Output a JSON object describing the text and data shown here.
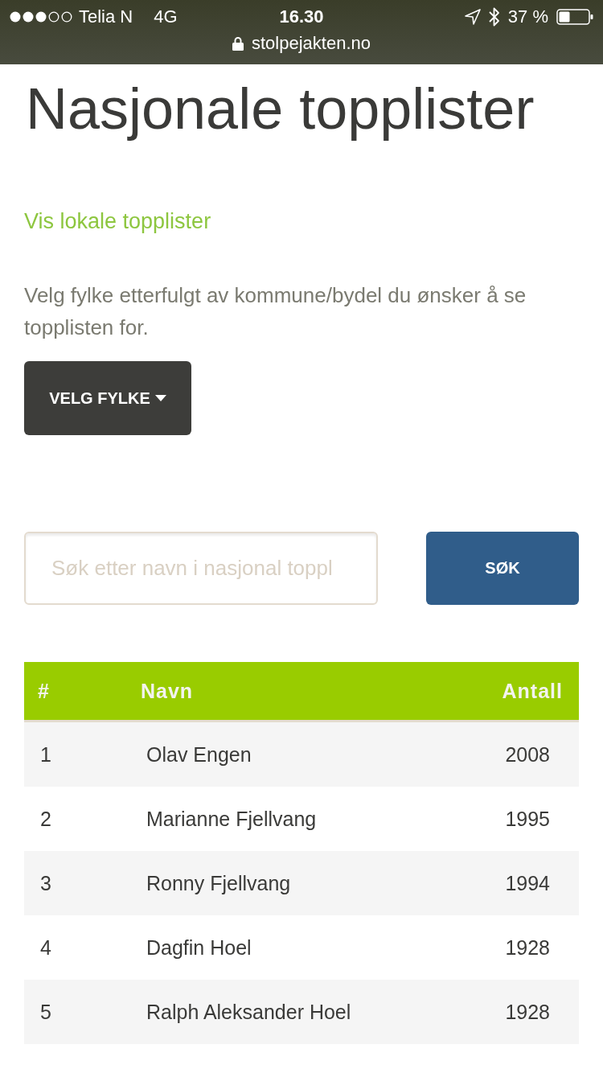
{
  "status_bar": {
    "carrier": "Telia N",
    "network": "4G",
    "time": "16.30",
    "battery": "37 %"
  },
  "address_bar": {
    "url": "stolpejakten.no"
  },
  "title": "Nasjonale topplister",
  "local_link": "Vis lokale topplister",
  "instructions": "Velg fylke etterfulgt av kommune/bydel du ønsker å se topplisten for.",
  "county_button": "VELG FYLKE",
  "search": {
    "placeholder": "Søk etter navn i nasjonal toppl",
    "button": "SØK"
  },
  "table": {
    "columns": [
      "#",
      "Navn",
      "Antall"
    ],
    "rows": [
      [
        "1",
        "Olav Engen",
        "2008"
      ],
      [
        "2",
        "Marianne Fjellvang",
        "1995"
      ],
      [
        "3",
        "Ronny Fjellvang",
        "1994"
      ],
      [
        "4",
        "Dagfin Hoel",
        "1928"
      ],
      [
        "5",
        "Ralph Aleksander Hoel",
        "1928"
      ]
    ]
  }
}
